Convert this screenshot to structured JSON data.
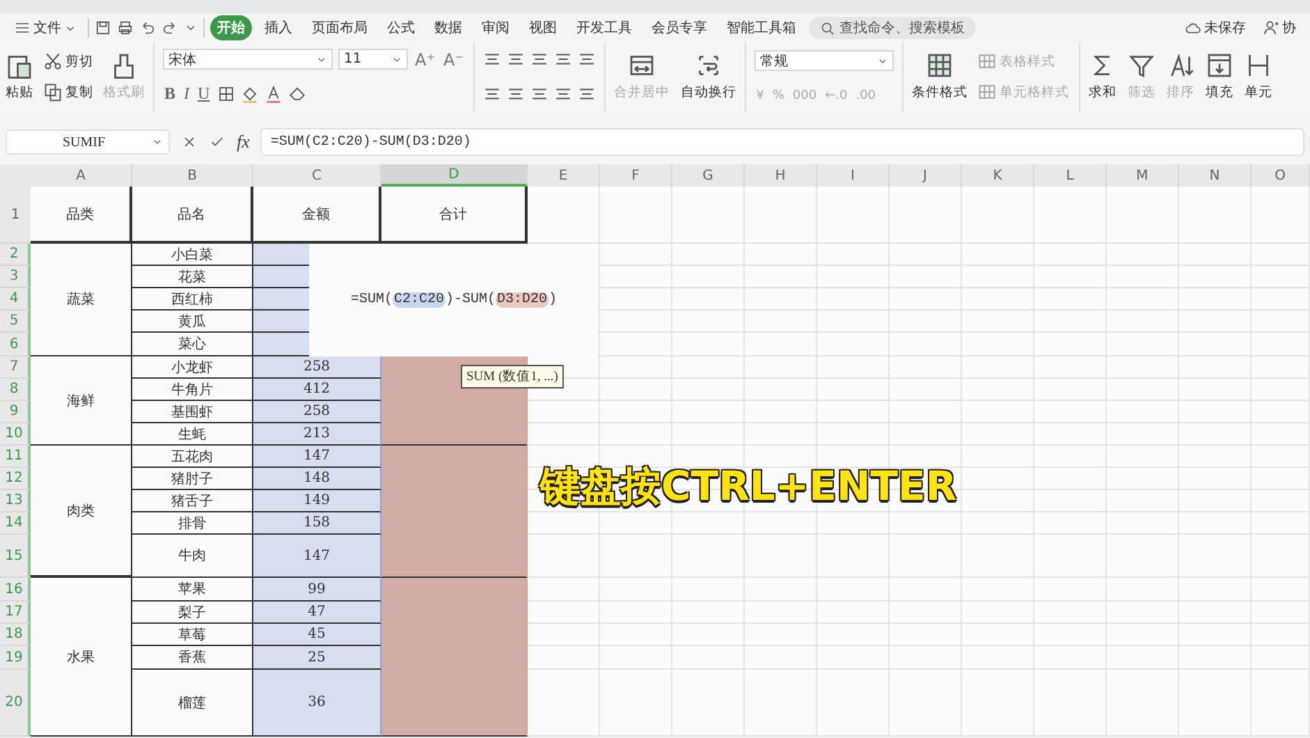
{
  "menu": {
    "file": "文件",
    "tabs": [
      {
        "label": "开始",
        "selected": true
      },
      {
        "label": "插入",
        "selected": false
      },
      {
        "label": "页面布局",
        "selected": false
      },
      {
        "label": "公式",
        "selected": false
      },
      {
        "label": "数据",
        "selected": false
      },
      {
        "label": "审阅",
        "selected": false
      },
      {
        "label": "视图",
        "selected": false
      },
      {
        "label": "开发工具",
        "selected": false
      },
      {
        "label": "会员专享",
        "selected": false
      },
      {
        "label": "智能工具箱",
        "selected": false
      }
    ],
    "search": {
      "placeholder": "查找命令、搜索模板"
    },
    "save_status": "未保存",
    "collab": "协"
  },
  "ribbon": {
    "paste": "粘贴",
    "cut": "剪切",
    "copy": "复制",
    "format_painter": {
      "label": "格式刷",
      "disabled": true
    },
    "font": {
      "name": "宋体",
      "size": "11",
      "size_buttons": [
        "A⁺",
        "A⁻"
      ],
      "style_buttons": [
        "B",
        "I",
        "U"
      ]
    },
    "merge": "合并居中",
    "wrap": "自动换行",
    "number": {
      "format": "常规",
      "buttons": [
        "¥",
        "%",
        "000",
        "←.0",
        ".00"
      ]
    },
    "styles": [
      {
        "label": "条件格式",
        "disabled": false
      },
      {
        "label": "表格样式",
        "disabled": true
      },
      {
        "label": "单元格样式",
        "disabled": true
      }
    ],
    "editing": [
      {
        "label": "求和",
        "disabled": false
      },
      {
        "label": "筛选",
        "disabled": true
      },
      {
        "label": "排序",
        "disabled": true
      },
      {
        "label": "填充",
        "disabled": false
      },
      {
        "label": "单元",
        "disabled": false
      }
    ]
  },
  "formula_bar": {
    "name_box": "SUMIF",
    "fx_label": "fx",
    "formula": "=SUM(C2:C20)-SUM(D3:D20)"
  },
  "sheet": {
    "columns": [
      {
        "label": "A",
        "selected": false
      },
      {
        "label": "B",
        "selected": false
      },
      {
        "label": "C",
        "selected": false,
        "color": "#d6deef"
      },
      {
        "label": "D",
        "selected": true,
        "color": "#d3aca6"
      },
      {
        "label": "E",
        "selected": false
      },
      {
        "label": "F",
        "selected": false
      },
      {
        "label": "G",
        "selected": false
      },
      {
        "label": "H",
        "selected": false
      },
      {
        "label": "I",
        "selected": false
      },
      {
        "label": "J",
        "selected": false
      },
      {
        "label": "K",
        "selected": false
      },
      {
        "label": "L",
        "selected": false
      },
      {
        "label": "M",
        "selected": false
      },
      {
        "label": "N",
        "selected": false
      },
      {
        "label": "O",
        "selected": false
      }
    ],
    "rows": [
      {
        "label": "1",
        "selected": false
      },
      {
        "label": "2",
        "selected": true
      },
      {
        "label": "3",
        "selected": true
      },
      {
        "label": "4",
        "selected": true
      },
      {
        "label": "5",
        "selected": true
      },
      {
        "label": "6",
        "selected": true
      },
      {
        "label": "7",
        "selected": true
      },
      {
        "label": "8",
        "selected": true
      },
      {
        "label": "9",
        "selected": true
      },
      {
        "label": "10",
        "selected": true
      },
      {
        "label": "11",
        "selected": true
      },
      {
        "label": "12",
        "selected": true
      },
      {
        "label": "13",
        "selected": true
      },
      {
        "label": "14",
        "selected": true
      },
      {
        "label": "15",
        "selected": true
      },
      {
        "label": "16",
        "selected": true
      },
      {
        "label": "17",
        "selected": true
      },
      {
        "label": "18",
        "selected": true
      },
      {
        "label": "19",
        "selected": true
      },
      {
        "label": "20",
        "selected": true
      }
    ],
    "headers": [
      "品类",
      "品名",
      "金额",
      "合计"
    ],
    "groups": [
      {
        "category": "蔬菜",
        "items": [
          {
            "name": "小白菜"
          },
          {
            "name": "花菜"
          },
          {
            "name": "西红柿"
          },
          {
            "name": "黄瓜"
          },
          {
            "name": "菜心"
          }
        ]
      },
      {
        "category": "海鲜",
        "items": [
          {
            "name": "小龙虾",
            "amount": "258"
          },
          {
            "name": "牛角片",
            "amount": "412"
          },
          {
            "name": "基围虾",
            "amount": "258"
          },
          {
            "name": "生蚝",
            "amount": "213"
          }
        ]
      },
      {
        "category": "肉类",
        "items": [
          {
            "name": "五花肉",
            "amount": "147"
          },
          {
            "name": "猪肘子",
            "amount": "148"
          },
          {
            "name": "猪舌子",
            "amount": "149"
          },
          {
            "name": "排骨",
            "amount": "158"
          },
          {
            "name": "牛肉",
            "amount": "147"
          }
        ]
      },
      {
        "category": "水果",
        "items": [
          {
            "name": "苹果",
            "amount": "99"
          },
          {
            "name": "梨子",
            "amount": "47"
          },
          {
            "name": "草莓",
            "amount": "45"
          },
          {
            "name": "香蕉",
            "amount": "25"
          },
          {
            "name": "榴莲",
            "amount": "36"
          }
        ]
      }
    ],
    "formula_popup": [
      {
        "kind": "plain",
        "text": "=SUM("
      },
      {
        "kind": "ref",
        "text": "C2:C20",
        "color": "#c9d6ef"
      },
      {
        "kind": "plain",
        "text": ")-SUM("
      },
      {
        "kind": "ref",
        "text": "D3:D20",
        "color": "#ecc6c0"
      },
      {
        "kind": "plain",
        "text": ")"
      }
    ],
    "tooltip": "SUM (数值1, ...)"
  },
  "caption": "键盘按CTRL+ENTER"
}
